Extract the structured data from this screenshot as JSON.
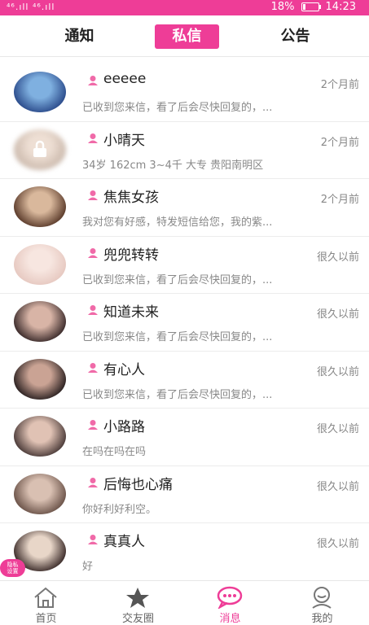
{
  "status_bar": {
    "signal_text": "⁴⁶.ıll ⁴⁶.ıll",
    "battery": "18%",
    "battery_level": 0.18,
    "time": "14:23"
  },
  "tabs": [
    {
      "label": "通知"
    },
    {
      "label": "私信",
      "active": true
    },
    {
      "label": "公告"
    }
  ],
  "colors": {
    "accent": "#ee3d97"
  },
  "messages": [
    {
      "name": "eeeee",
      "time": "2个月前",
      "preview": "已收到您来信，看了后会尽快回复的，...",
      "locked": false
    },
    {
      "name": "小晴天",
      "time": "2个月前",
      "preview": "34岁 162cm 3~4千 大专 贵阳南明区",
      "locked": true
    },
    {
      "name": "焦焦女孩",
      "time": "2个月前",
      "preview": "我对您有好感，特发短信给您，我的紫...",
      "locked": false
    },
    {
      "name": "兜兜转转",
      "time": "很久以前",
      "preview": "已收到您来信，看了后会尽快回复的，...",
      "locked": false
    },
    {
      "name": "知道未来",
      "time": "很久以前",
      "preview": "已收到您来信，看了后会尽快回复的，...",
      "locked": false
    },
    {
      "name": "有心人",
      "time": "很久以前",
      "preview": "已收到您来信，看了后会尽快回复的，...",
      "locked": false
    },
    {
      "name": "小路路",
      "time": "很久以前",
      "preview": "在吗在吗在吗",
      "locked": false
    },
    {
      "name": "后悔也心痛",
      "time": "很久以前",
      "preview": "你好利好利空。",
      "locked": false
    },
    {
      "name": "真真人",
      "time": "很久以前",
      "preview": "好",
      "locked": false
    }
  ],
  "privacy_badge": {
    "line1": "隐私",
    "line2": "设置"
  },
  "bottom_nav": [
    {
      "label": "首页",
      "icon": "home-icon"
    },
    {
      "label": "交友圈",
      "icon": "star-icon"
    },
    {
      "label": "消息",
      "icon": "chat-bubble-icon",
      "active": true
    },
    {
      "label": "我的",
      "icon": "profile-icon"
    }
  ]
}
